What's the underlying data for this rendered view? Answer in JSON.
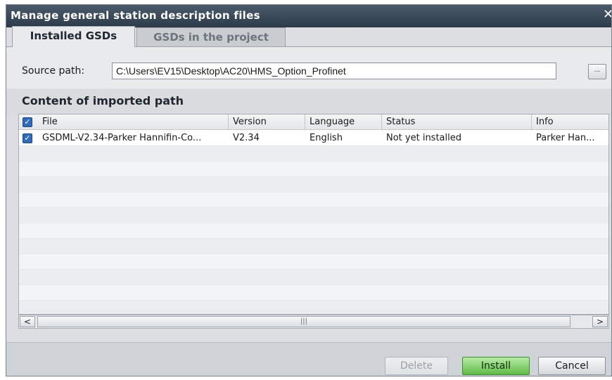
{
  "window": {
    "title": "Manage general station description files",
    "close_symbol": "✕"
  },
  "tabs": [
    {
      "label": "Installed GSDs",
      "active": true
    },
    {
      "label": "GSDs in the project",
      "active": false
    }
  ],
  "source": {
    "label": "Source path:",
    "value": "C:\\Users\\EV15\\Desktop\\AC20\\HMS_Option_Profinet",
    "browse_label": "..."
  },
  "content": {
    "title": "Content of imported path",
    "columns": [
      "File",
      "Version",
      "Language",
      "Status",
      "Info"
    ],
    "rows": [
      {
        "checked": true,
        "file": "GSDML-V2.34-Parker Hannifin-Co...",
        "version": "V2.34",
        "language": "English",
        "status": "Not yet installed",
        "info": "Parker Han..."
      }
    ]
  },
  "scrollbar": {
    "left_arrow": "<",
    "right_arrow": ">",
    "thumb_grip": "|||"
  },
  "buttons": {
    "delete": "Delete",
    "install": "Install",
    "cancel": "Cancel"
  },
  "colors": {
    "install_green": "#5fbb47",
    "checkbox_blue": "#2f6bb7",
    "titlebar": "#2d3b49"
  }
}
